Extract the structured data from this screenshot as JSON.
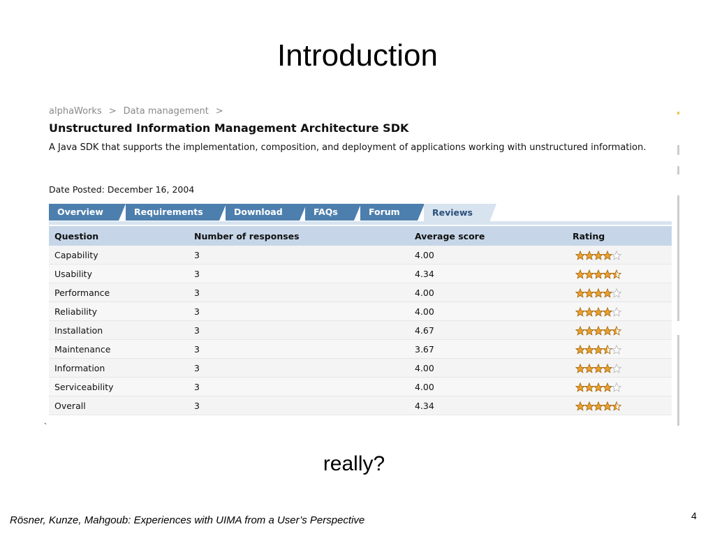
{
  "slide": {
    "title": "Introduction",
    "caption": "really?",
    "footer": "Rösner, Kunze, Mahgoub: Experiences with UIMA from a User’s Perspective",
    "page_number": "4",
    "bullet": "`"
  },
  "page": {
    "breadcrumb": [
      "alphaWorks",
      "Data management"
    ],
    "breadcrumb_sep": ">",
    "title": "Unstructured Information Management Architecture SDK",
    "description": "A Java SDK that supports the implementation, composition, and deployment of applications working with unstructured information.",
    "date_posted": "Date Posted: December 16, 2004"
  },
  "tabs": [
    "Overview",
    "Requirements",
    "Download",
    "FAQs",
    "Forum",
    "Reviews"
  ],
  "active_tab": "Reviews",
  "table": {
    "headers": [
      "Question",
      "Number of responses",
      "Average score",
      "Rating"
    ],
    "rows": [
      {
        "question": "Capability",
        "responses": "3",
        "score": "4.00",
        "stars": 4
      },
      {
        "question": "Usability",
        "responses": "3",
        "score": "4.34",
        "stars": 4.5
      },
      {
        "question": "Performance",
        "responses": "3",
        "score": "4.00",
        "stars": 4
      },
      {
        "question": "Reliability",
        "responses": "3",
        "score": "4.00",
        "stars": 4
      },
      {
        "question": "Installation",
        "responses": "3",
        "score": "4.67",
        "stars": 4.5
      },
      {
        "question": "Maintenance",
        "responses": "3",
        "score": "3.67",
        "stars": 3.5
      },
      {
        "question": "Information",
        "responses": "3",
        "score": "4.00",
        "stars": 4
      },
      {
        "question": "Serviceability",
        "responses": "3",
        "score": "4.00",
        "stars": 4
      },
      {
        "question": "Overall",
        "responses": "3",
        "score": "4.34",
        "stars": 4.5
      }
    ]
  },
  "colors": {
    "tab": "#4d7fae",
    "tab_active": "#d7e3ef",
    "header_row": "#c6d6e8",
    "star": "#e8a030"
  },
  "icons": {
    "rating": "star-icon"
  }
}
